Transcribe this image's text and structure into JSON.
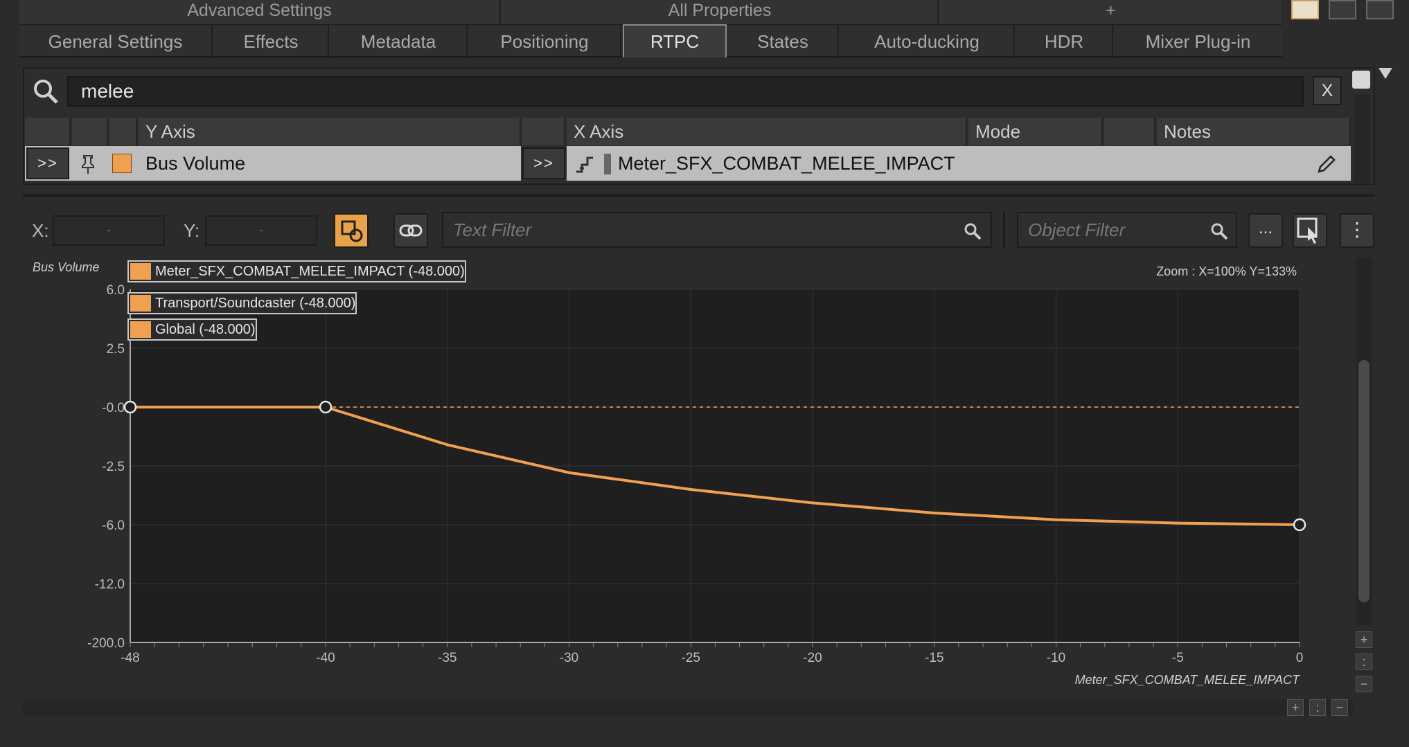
{
  "top_tabs": [
    "Advanced Settings",
    "All Properties",
    "+"
  ],
  "tabs": [
    "General Settings",
    "Effects",
    "Metadata",
    "Positioning",
    "RTPC",
    "States",
    "Auto-ducking",
    "HDR",
    "Mixer Plug-in"
  ],
  "active_tab": "RTPC",
  "search": {
    "value": "melee",
    "clear_label": "X"
  },
  "table": {
    "headers": {
      "y_axis": "Y Axis",
      "x_axis": "X Axis",
      "mode": "Mode",
      "notes": "Notes"
    },
    "row": {
      "expand_label": ">>",
      "y_axis": "Bus Volume",
      "x_expand_label": ">>",
      "x_axis": "Meter_SFX_COMBAT_MELEE_IMPACT"
    }
  },
  "toolbar": {
    "x_label": "X:",
    "x_value": "-",
    "y_label": "Y:",
    "y_value": "-",
    "text_filter_placeholder": "Text Filter",
    "object_filter_placeholder": "Object Filter",
    "more_label": "...",
    "menu_label": "⋮"
  },
  "colors": {
    "curve": "#f0a050",
    "accent": "#f0a050"
  },
  "chart_data": {
    "type": "line",
    "ylabel": "Bus Volume",
    "xlabel": "Meter_SFX_COMBAT_MELEE_IMPACT",
    "zoom_label": "Zoom : X=100% Y=133%",
    "legend": [
      "Meter_SFX_COMBAT_MELEE_IMPACT (-48.000)",
      "Transport/Soundcaster (-48.000)",
      "Global (-48.000)"
    ],
    "y_ticks": [
      "6.0",
      "2.5",
      "-0.0",
      "-2.5",
      "-6.0",
      "-12.0",
      "-200.0"
    ],
    "x_ticks": [
      "-48",
      "-40",
      "-35",
      "-30",
      "-25",
      "-20",
      "-15",
      "-10",
      "-5",
      "0"
    ],
    "xlim": [
      -48,
      0
    ],
    "points": [
      {
        "x": -48,
        "y": 0
      },
      {
        "x": -40,
        "y": 0
      },
      {
        "x": 0,
        "y": -6
      }
    ],
    "curve_samples": [
      {
        "x": -40,
        "y": 0
      },
      {
        "x": -35,
        "y": -1.6
      },
      {
        "x": -30,
        "y": -2.9
      },
      {
        "x": -25,
        "y": -3.9
      },
      {
        "x": -20,
        "y": -4.7
      },
      {
        "x": -15,
        "y": -5.3
      },
      {
        "x": -10,
        "y": -5.7
      },
      {
        "x": -5,
        "y": -5.9
      },
      {
        "x": 0,
        "y": -6
      }
    ],
    "reference_line_y": 0
  }
}
